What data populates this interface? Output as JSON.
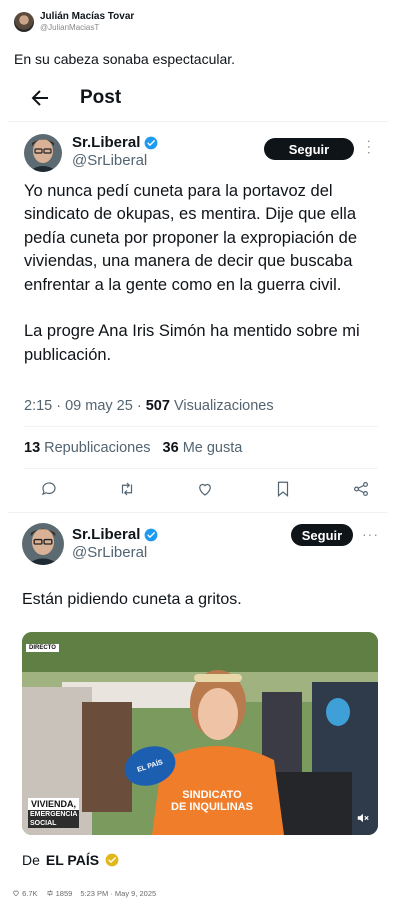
{
  "outer": {
    "name": "Julián Macías Tovar",
    "handle": "@JulianMaciasT",
    "text": "En su cabeza sonaba espectacular.",
    "footer": {
      "likes": "6.7K",
      "retweets": "1859",
      "timestamp": "5:23 PM · May 9, 2025"
    }
  },
  "screen": {
    "title": "Post",
    "tweet1": {
      "name": "Sr.Liberal",
      "handle": "@SrLiberal",
      "follow_label": "Seguir",
      "text": "Yo nunca pedí cuneta para la portavoz del sindicato de okupas, es mentira. Dije que ella pedía cuneta por proponer la expropiación de viviendas, una manera de decir que buscaba enfrentar a la gente como en la guerra civil.\n\nLa progre Ana Iris Simón ha mentido sobre mi publicación.",
      "time": "2:15 · 09 may 25 · ",
      "views_count": "507",
      "views_label": "Visualizaciones",
      "reposts_count": "13",
      "reposts_label": "Republicaciones",
      "likes_count": "36",
      "likes_label": "Me gusta"
    },
    "tweet2": {
      "name": "Sr.Liberal",
      "handle": "@SrLiberal",
      "follow_label": "Seguir",
      "text": "Están pidiendo cuneta a gritos.",
      "video": {
        "live_badge": "DIRECTO",
        "mic_logo": "EL PAÍS",
        "caption_line1": "VIVIENDA,",
        "caption_line2": "EMERGENCIA",
        "caption_line3": "SOCIAL",
        "shirt_line1": "SINDICATO",
        "shirt_line2": "DE INQUILINAS"
      },
      "source_prefix": "De",
      "source_name": "EL PAÍS"
    }
  },
  "colors": {
    "verified_blue": "#1d9bf0",
    "gold_badge": "#e2b719",
    "button_black": "#0f1419",
    "muted_text": "#536471"
  }
}
